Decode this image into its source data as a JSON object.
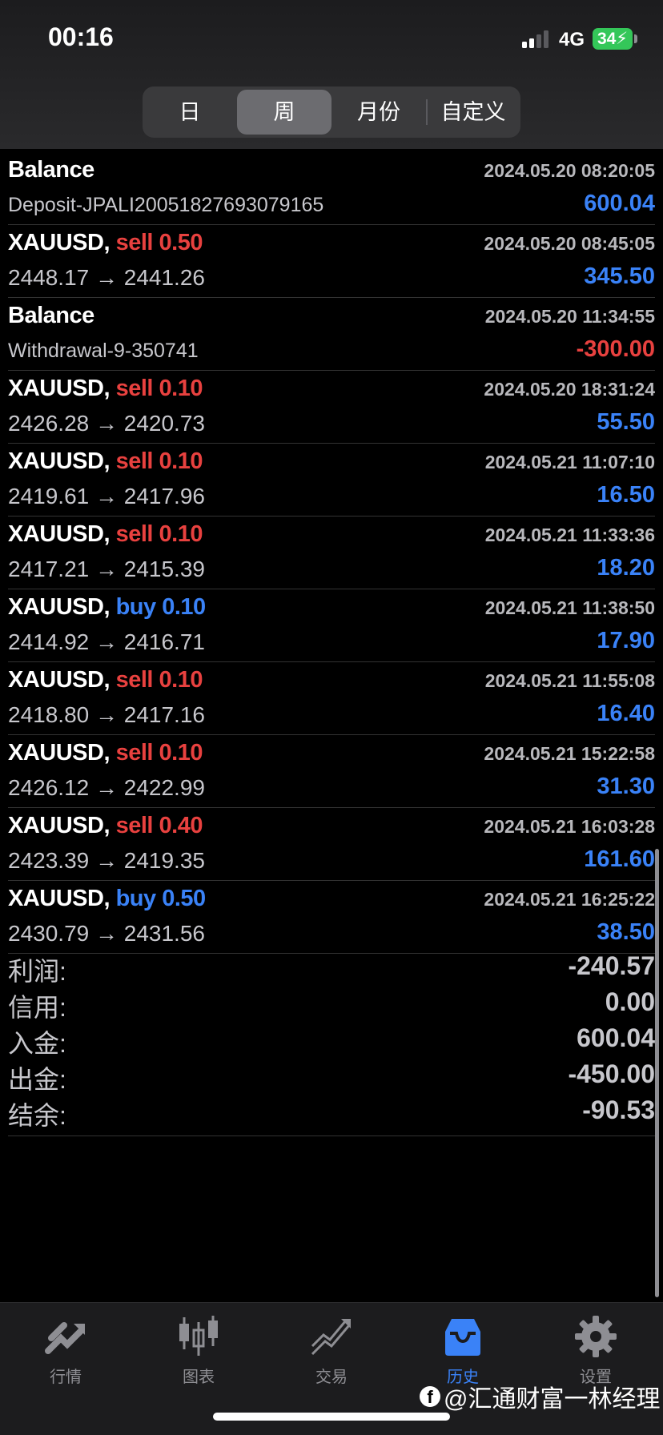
{
  "status_bar": {
    "time": "00:16",
    "network": "4G",
    "battery": "34"
  },
  "period_tabs": [
    "日",
    "周",
    "月份",
    "自定义"
  ],
  "active_period": "周",
  "rows": [
    {
      "title": "Balance",
      "type": "",
      "volume": "",
      "time": "2024.05.20 08:20:05",
      "detail": "Deposit-JPALI20051827693079165",
      "amount": "600.04",
      "sign": "pos"
    },
    {
      "title": "XAUUSD",
      "type": "sell",
      "volume": "0.50",
      "time": "2024.05.20 08:45:05",
      "detail": "2448.17 → 2441.26",
      "amount": "345.50",
      "sign": "pos"
    },
    {
      "title": "Balance",
      "type": "",
      "volume": "",
      "time": "2024.05.20 11:34:55",
      "detail": "Withdrawal-9-350741",
      "amount": "-300.00",
      "sign": "neg"
    },
    {
      "title": "XAUUSD",
      "type": "sell",
      "volume": "0.10",
      "time": "2024.05.20 18:31:24",
      "detail": "2426.28 → 2420.73",
      "amount": "55.50",
      "sign": "pos"
    },
    {
      "title": "XAUUSD",
      "type": "sell",
      "volume": "0.10",
      "time": "2024.05.21 11:07:10",
      "detail": "2419.61 → 2417.96",
      "amount": "16.50",
      "sign": "pos"
    },
    {
      "title": "XAUUSD",
      "type": "sell",
      "volume": "0.10",
      "time": "2024.05.21 11:33:36",
      "detail": "2417.21 → 2415.39",
      "amount": "18.20",
      "sign": "pos"
    },
    {
      "title": "XAUUSD",
      "type": "buy",
      "volume": "0.10",
      "time": "2024.05.21 11:38:50",
      "detail": "2414.92 → 2416.71",
      "amount": "17.90",
      "sign": "pos"
    },
    {
      "title": "XAUUSD",
      "type": "sell",
      "volume": "0.10",
      "time": "2024.05.21 11:55:08",
      "detail": "2418.80 → 2417.16",
      "amount": "16.40",
      "sign": "pos"
    },
    {
      "title": "XAUUSD",
      "type": "sell",
      "volume": "0.10",
      "time": "2024.05.21 15:22:58",
      "detail": "2426.12 → 2422.99",
      "amount": "31.30",
      "sign": "pos"
    },
    {
      "title": "XAUUSD",
      "type": "sell",
      "volume": "0.40",
      "time": "2024.05.21 16:03:28",
      "detail": "2423.39 → 2419.35",
      "amount": "161.60",
      "sign": "pos"
    },
    {
      "title": "XAUUSD",
      "type": "buy",
      "volume": "0.50",
      "time": "2024.05.21 16:25:22",
      "detail": "2430.79 → 2431.56",
      "amount": "38.50",
      "sign": "pos"
    }
  ],
  "summary": [
    {
      "label": "利润:",
      "value": "-240.57"
    },
    {
      "label": "信用:",
      "value": "0.00"
    },
    {
      "label": "入金:",
      "value": "600.04"
    },
    {
      "label": "出金:",
      "value": "-450.00"
    },
    {
      "label": "结余:",
      "value": "-90.53"
    }
  ],
  "tabbar": [
    {
      "label": "行情",
      "icon": "quotes-icon"
    },
    {
      "label": "图表",
      "icon": "chart-icon"
    },
    {
      "label": "交易",
      "icon": "trade-icon"
    },
    {
      "label": "历史",
      "icon": "history-icon"
    },
    {
      "label": "设置",
      "icon": "settings-icon"
    }
  ],
  "active_tab": "历史",
  "watermark": "@汇通财富一林经理",
  "colors": {
    "profit": "#3a82f7",
    "loss": "#e8413f",
    "buy": "#3a82f7",
    "sell": "#e8413f",
    "active_tab": "#3a82f7"
  }
}
